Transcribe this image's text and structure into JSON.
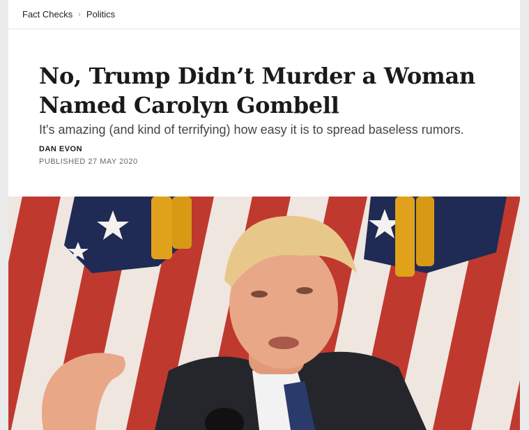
{
  "breadcrumb": {
    "items": [
      "Fact Checks",
      "Politics"
    ],
    "separator": "›"
  },
  "article": {
    "title": "No, Trump Didn’t Murder a Woman Named Carolyn Gombell",
    "subtitle": "It's amazing (and kind of terrifying) how easy it is to spread baseless rumors.",
    "author": "DAN EVON",
    "published_label": "PUBLISHED",
    "published_date": "27 MAY 2020"
  },
  "colors": {
    "page_bg": "#ebebeb",
    "card_bg": "#ffffff",
    "flag_red": "#c0392f",
    "flag_blue": "#1f2a55",
    "fringe_gold": "#e0a21a"
  }
}
